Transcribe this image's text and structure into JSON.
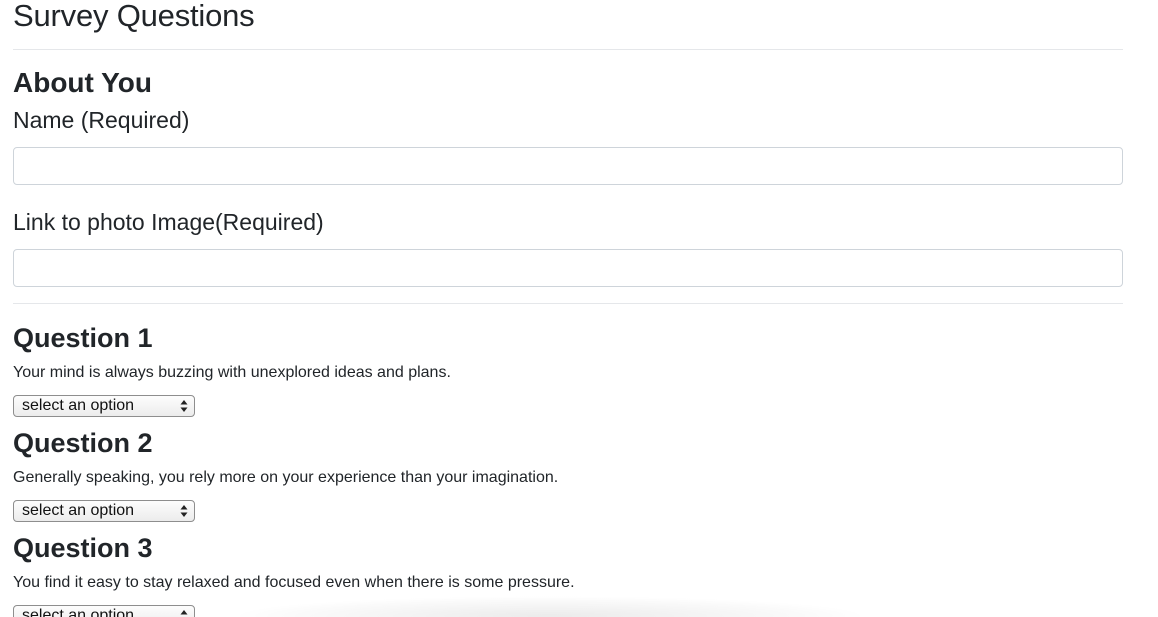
{
  "page": {
    "title": "Survey Questions"
  },
  "about": {
    "heading": "About You",
    "name_label": "Name (Required)",
    "name_value": "",
    "photo_label": "Link to photo Image(Required)",
    "photo_value": ""
  },
  "questions": [
    {
      "title": "Question 1",
      "text": "Your mind is always buzzing with unexplored ideas and plans.",
      "selected": "select an option"
    },
    {
      "title": "Question 2",
      "text": "Generally speaking, you rely more on your experience than your imagination.",
      "selected": "select an option"
    },
    {
      "title": "Question 3",
      "text": "You find it easy to stay relaxed and focused even when there is some pressure.",
      "selected": "select an option"
    }
  ],
  "icons": {
    "select_arrow": "select-arrows-icon"
  },
  "colors": {
    "text": "#212529",
    "input_border": "#ced4da",
    "rule": "#e5e7ea"
  }
}
